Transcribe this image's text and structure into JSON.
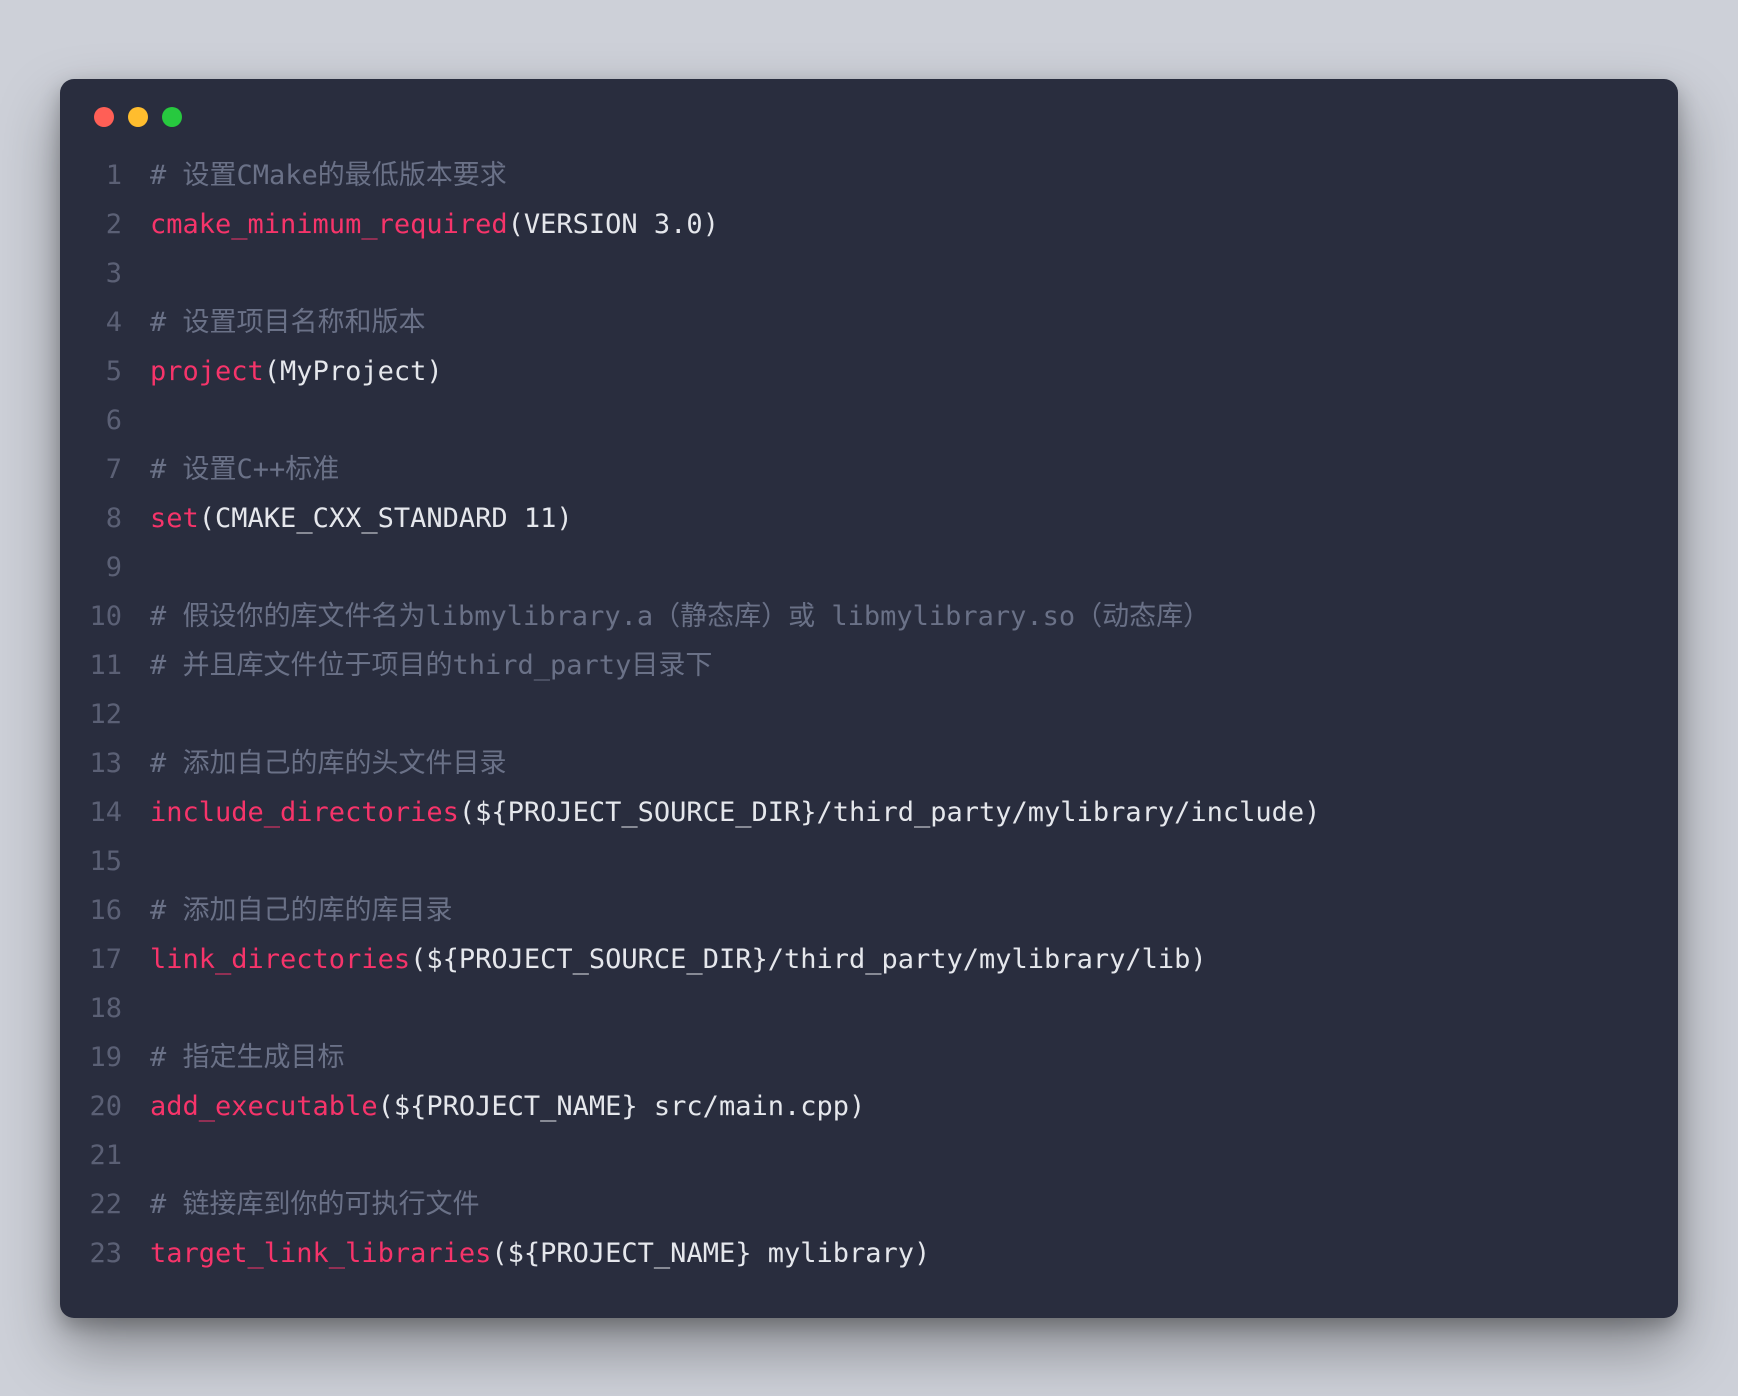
{
  "window": {
    "traffic_lights": [
      "red",
      "yellow",
      "green"
    ]
  },
  "colors": {
    "background": "#292d3e",
    "comment": "#6a7187",
    "keyword": "#f6346a",
    "default": "#e5e7ec",
    "gutter": "#5b6075",
    "page_bg": "#cdd0d8"
  },
  "code": {
    "lines": [
      {
        "n": 1,
        "tokens": [
          {
            "t": "comment",
            "s": "# 设置CMake的最低版本要求"
          }
        ]
      },
      {
        "n": 2,
        "tokens": [
          {
            "t": "keyword",
            "s": "cmake_minimum_required"
          },
          {
            "t": "default",
            "s": "(VERSION 3.0)"
          }
        ]
      },
      {
        "n": 3,
        "tokens": []
      },
      {
        "n": 4,
        "tokens": [
          {
            "t": "comment",
            "s": "# 设置项目名称和版本"
          }
        ]
      },
      {
        "n": 5,
        "tokens": [
          {
            "t": "keyword",
            "s": "project"
          },
          {
            "t": "default",
            "s": "(MyProject)"
          }
        ]
      },
      {
        "n": 6,
        "tokens": []
      },
      {
        "n": 7,
        "tokens": [
          {
            "t": "comment",
            "s": "# 设置C++标准"
          }
        ]
      },
      {
        "n": 8,
        "tokens": [
          {
            "t": "keyword",
            "s": "set"
          },
          {
            "t": "default",
            "s": "(CMAKE_CXX_STANDARD 11)"
          }
        ]
      },
      {
        "n": 9,
        "tokens": []
      },
      {
        "n": 10,
        "tokens": [
          {
            "t": "comment",
            "s": "# 假设你的库文件名为libmylibrary.a（静态库）或 libmylibrary.so（动态库）"
          }
        ]
      },
      {
        "n": 11,
        "tokens": [
          {
            "t": "comment",
            "s": "# 并且库文件位于项目的third_party目录下"
          }
        ]
      },
      {
        "n": 12,
        "tokens": []
      },
      {
        "n": 13,
        "tokens": [
          {
            "t": "comment",
            "s": "# 添加自己的库的头文件目录"
          }
        ]
      },
      {
        "n": 14,
        "tokens": [
          {
            "t": "keyword",
            "s": "include_directories"
          },
          {
            "t": "default",
            "s": "(${PROJECT_SOURCE_DIR}/third_party/mylibrary/include)"
          }
        ]
      },
      {
        "n": 15,
        "tokens": []
      },
      {
        "n": 16,
        "tokens": [
          {
            "t": "comment",
            "s": "# 添加自己的库的库目录"
          }
        ]
      },
      {
        "n": 17,
        "tokens": [
          {
            "t": "keyword",
            "s": "link_directories"
          },
          {
            "t": "default",
            "s": "(${PROJECT_SOURCE_DIR}/third_party/mylibrary/lib)"
          }
        ]
      },
      {
        "n": 18,
        "tokens": []
      },
      {
        "n": 19,
        "tokens": [
          {
            "t": "comment",
            "s": "# 指定生成目标"
          }
        ]
      },
      {
        "n": 20,
        "tokens": [
          {
            "t": "keyword",
            "s": "add_executable"
          },
          {
            "t": "default",
            "s": "(${PROJECT_NAME} src/main.cpp)"
          }
        ]
      },
      {
        "n": 21,
        "tokens": []
      },
      {
        "n": 22,
        "tokens": [
          {
            "t": "comment",
            "s": "# 链接库到你的可执行文件"
          }
        ]
      },
      {
        "n": 23,
        "tokens": [
          {
            "t": "keyword",
            "s": "target_link_libraries"
          },
          {
            "t": "default",
            "s": "(${PROJECT_NAME} mylibrary)"
          }
        ]
      }
    ]
  }
}
